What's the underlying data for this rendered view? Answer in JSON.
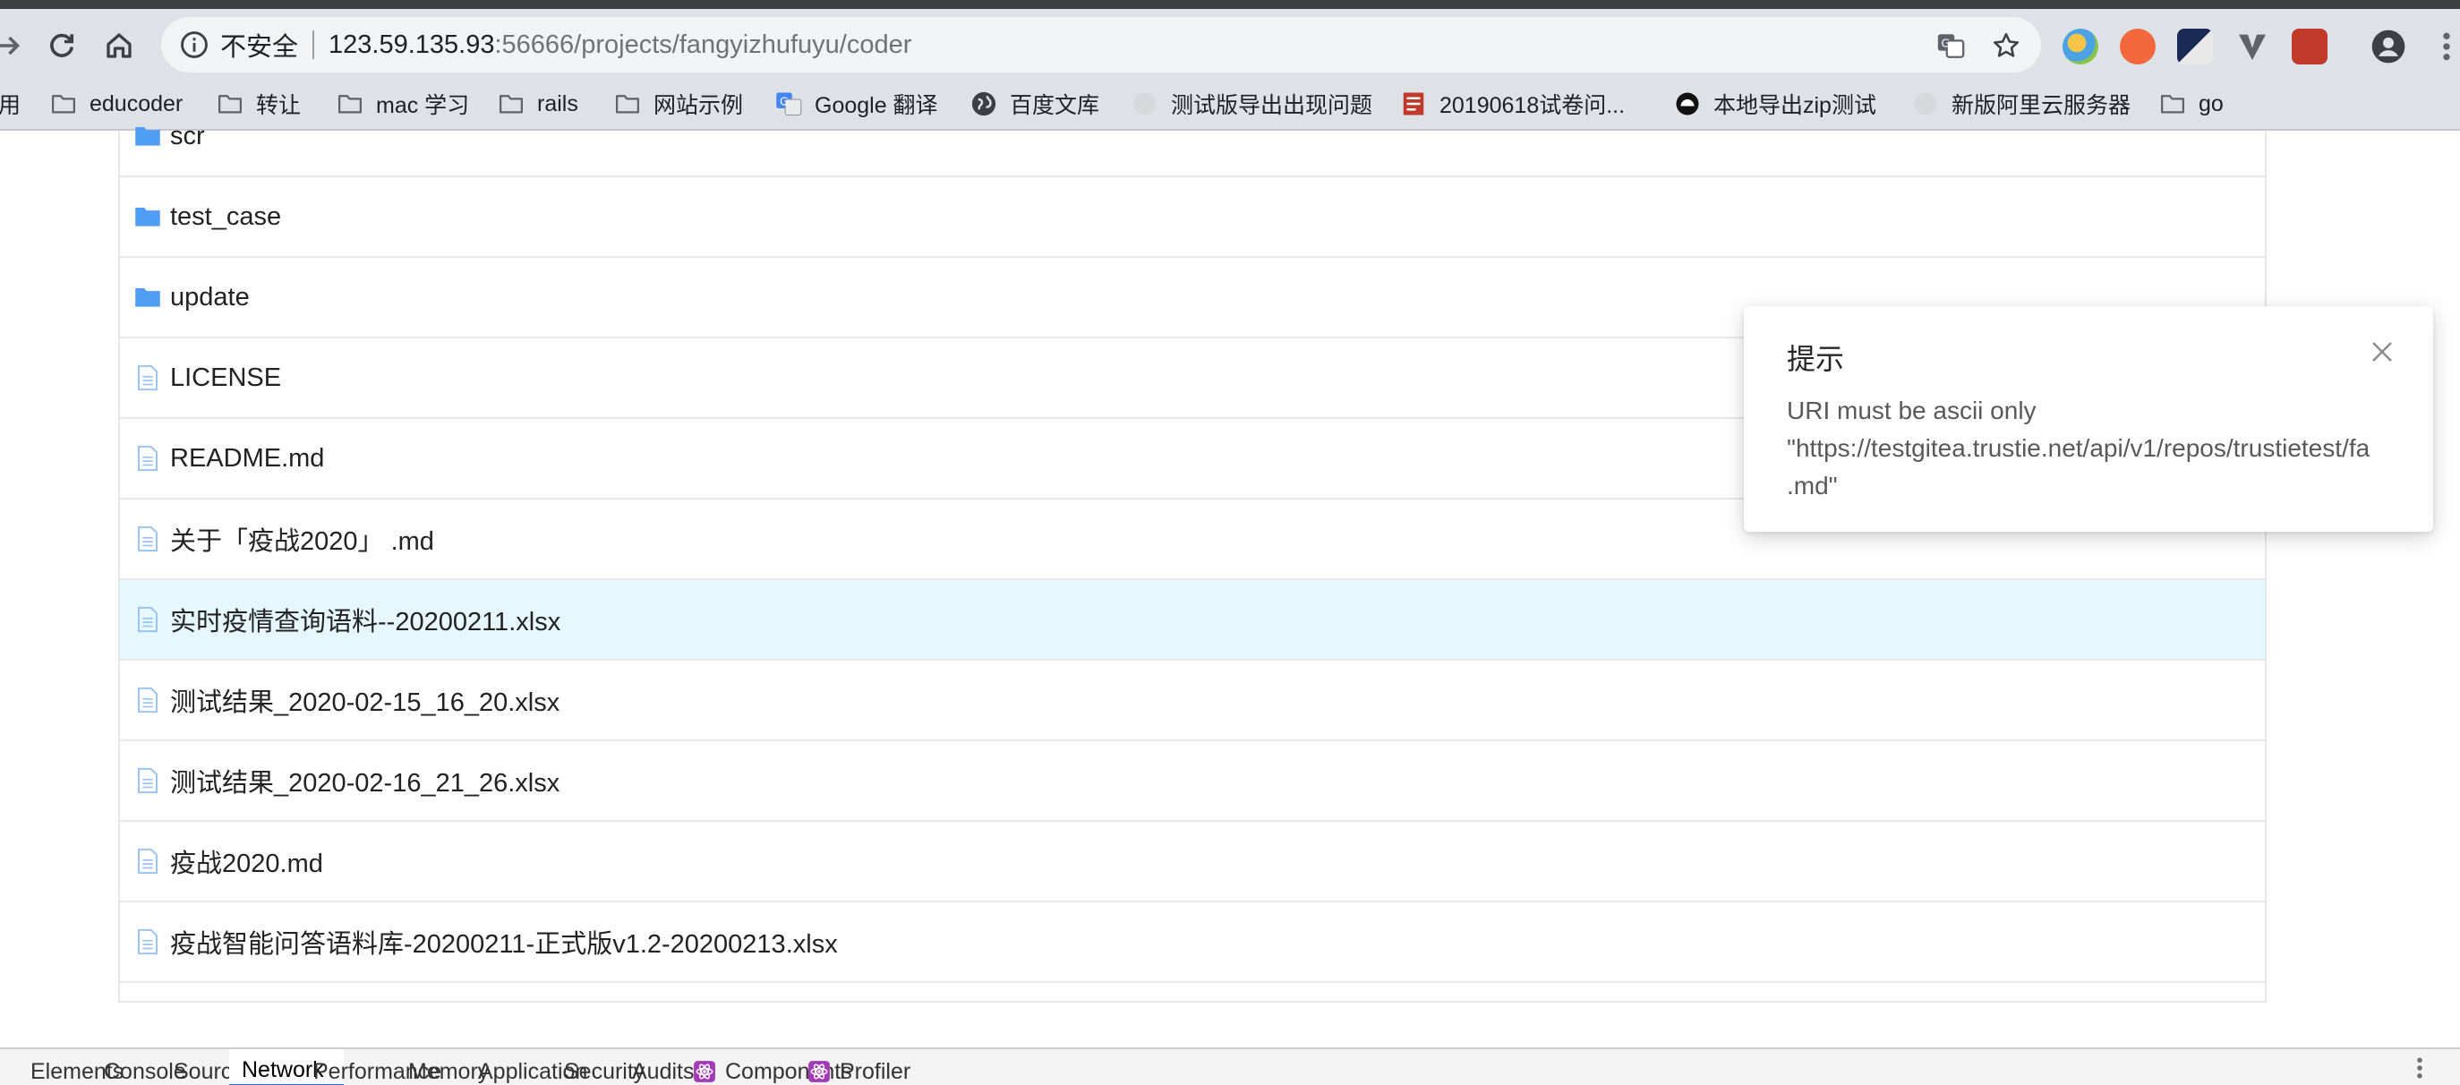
{
  "browser": {
    "security_label": "不安全",
    "url_host": "123.59.135.93",
    "url_path": ":56666/projects/fangyizhufuyu/coder"
  },
  "bookmarks": [
    {
      "label": "用",
      "icon": "apps-icon"
    },
    {
      "label": "educoder",
      "icon": "folder-icon"
    },
    {
      "label": "转让",
      "icon": "folder-icon"
    },
    {
      "label": "mac 学习",
      "icon": "folder-icon"
    },
    {
      "label": "rails",
      "icon": "folder-icon"
    },
    {
      "label": "网站示例",
      "icon": "folder-icon"
    },
    {
      "label": "Google 翻译",
      "icon": "google-translate-icon"
    },
    {
      "label": "百度文库",
      "icon": "globe-icon"
    },
    {
      "label": "测试版导出出现问题",
      "icon": "site-icon"
    },
    {
      "label": "20190618试卷问...",
      "icon": "site-icon"
    },
    {
      "label": "本地导出zip测试",
      "icon": "site-icon"
    },
    {
      "label": "新版阿里云服务器",
      "icon": "site-icon"
    },
    {
      "label": "go",
      "icon": "folder-icon"
    }
  ],
  "files": [
    {
      "name": "scr",
      "type": "folder"
    },
    {
      "name": "test_case",
      "type": "folder"
    },
    {
      "name": "update",
      "type": "folder"
    },
    {
      "name": "LICENSE",
      "type": "file"
    },
    {
      "name": "README.md",
      "type": "file"
    },
    {
      "name": "关于「疫战2020」 .md",
      "type": "file"
    },
    {
      "name": "实时疫情查询语料--20200211.xlsx",
      "type": "file",
      "highlighted": true
    },
    {
      "name": "测试结果_2020-02-15_16_20.xlsx",
      "type": "file"
    },
    {
      "name": "测试结果_2020-02-16_21_26.xlsx",
      "type": "file"
    },
    {
      "name": "疫战2020.md",
      "type": "file"
    },
    {
      "name": "疫战智能问答语料库-20200211-正式版v1.2-20200213.xlsx",
      "type": "file"
    }
  ],
  "notification": {
    "title": "提示",
    "line1": "URI must be ascii only",
    "line2": "\"https://testgitea.trustie.net/api/v1/repos/trustietest/fa",
    "line3": ".md\""
  },
  "devtools": {
    "tabs": [
      {
        "label": "Elements"
      },
      {
        "label": "Console"
      },
      {
        "label": "Sources"
      },
      {
        "label": "Network",
        "active": true
      },
      {
        "label": "Performance"
      },
      {
        "label": "Memory"
      },
      {
        "label": "Application"
      },
      {
        "label": "Security"
      },
      {
        "label": "Audits"
      },
      {
        "label": "Components",
        "icon": "react-icon"
      },
      {
        "label": "Profiler",
        "icon": "react-icon"
      }
    ]
  },
  "colors": {
    "folder": "#4f9df5",
    "file_icon": "#9cc4ec",
    "highlight_row": "#e6f7ff",
    "toolbar": "#dee1e6"
  }
}
